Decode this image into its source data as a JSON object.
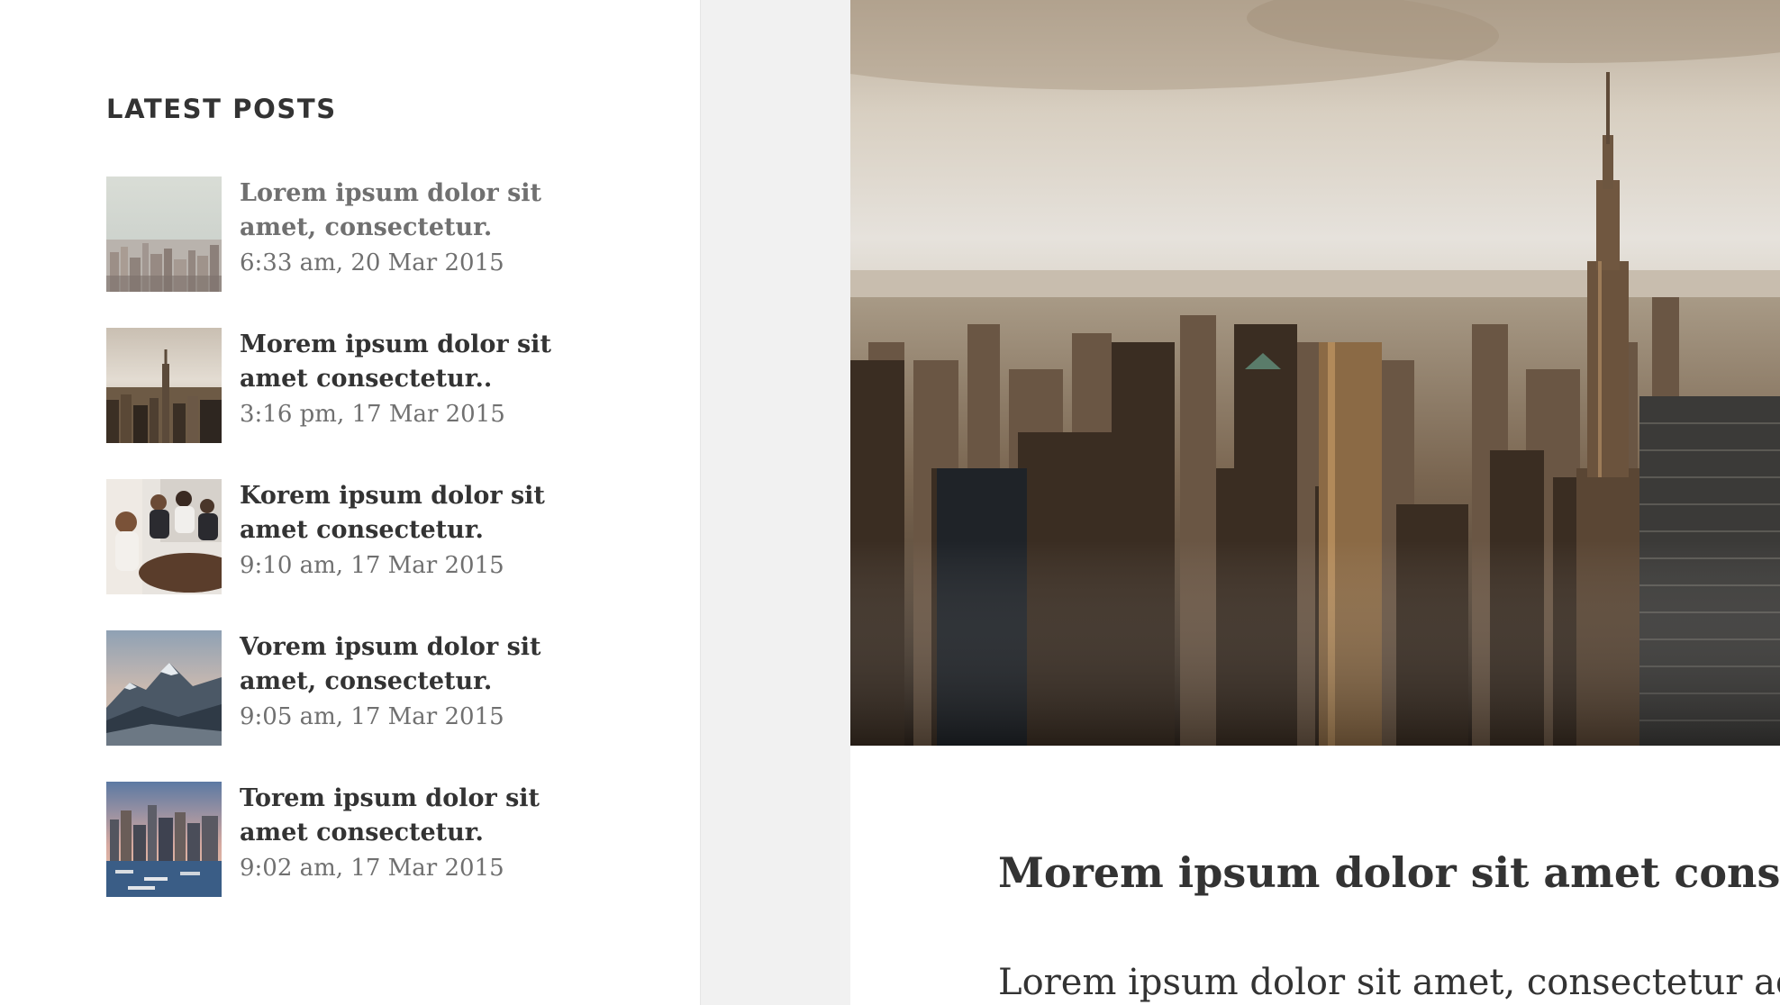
{
  "sidebar": {
    "widget_title": "LATEST POSTS",
    "posts": [
      {
        "title": "Lorem ipsum dolor sit amet, consectetur.",
        "date": "6:33 am, 20 Mar 2015",
        "thumb": "city-skyline-haze"
      },
      {
        "title": "Morem ipsum dolor sit amet consectetur..",
        "date": "3:16 pm, 17 Mar 2015",
        "thumb": "city-empire-state"
      },
      {
        "title": "Korem ipsum dolor sit amet consectetur.",
        "date": "9:10 am, 17 Mar 2015",
        "thumb": "business-meeting"
      },
      {
        "title": "Vorem ipsum dolor sit amet, consectetur.",
        "date": "9:05 am, 17 Mar 2015",
        "thumb": "snowy-mountains"
      },
      {
        "title": "Torem ipsum dolor sit amet consectetur.",
        "date": "9:02 am, 17 Mar 2015",
        "thumb": "harbor-city-dusk"
      }
    ]
  },
  "article": {
    "hero_image": "city-skyline-empire-state",
    "title": "Morem ipsum dolor sit amet consectetur..",
    "excerpt": "Lorem ipsum dolor sit amet, consectetur adipiscing elit."
  },
  "colors": {
    "page_background": "#f1f1f1",
    "card_background": "#ffffff",
    "text_dark": "#333333",
    "text_muted": "#707070"
  }
}
